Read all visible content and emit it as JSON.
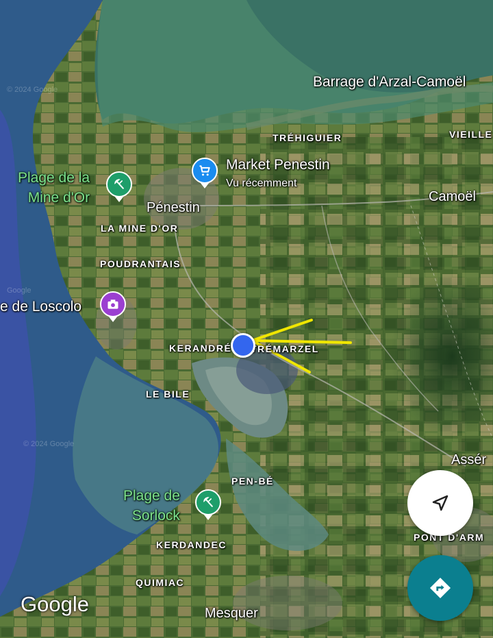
{
  "map": {
    "places": {
      "barrage": "Barrage d'Arzal-Camoël",
      "trehiguier": "TRÉHIGUIER",
      "vieille": "VIEILLE",
      "camoel": "Camoël",
      "penestin": "Pénestin",
      "la_mine_dor": "LA MINE D'OR",
      "poudrantais": "POUDRANTAIS",
      "kerandre": "KERANDRÉ",
      "tremarzel": "TRÉMARZEL",
      "le_bile": "LE BILE",
      "assere": "Assér",
      "pen_be": "PEN-BÉ",
      "kerdandec": "KERDANDEC",
      "quimiac": "QUIMIAC",
      "mesquer": "Mesquer",
      "pont_darm": "PONT D'ARM"
    },
    "pois": {
      "market": {
        "name": "Market Penestin",
        "subtitle": "Vu récemment",
        "icon": "shopping-cart-icon",
        "color": "#1a8cf0"
      },
      "mine_dor": {
        "line1": "Plage de la",
        "line2": "Mine d'Or",
        "icon": "beach-umbrella-icon",
        "color": "#1e9e6a"
      },
      "loscolo": {
        "name": "e de Loscolo",
        "icon": "camera-icon",
        "color": "#9b3fd1"
      },
      "sorlock": {
        "line1": "Plage de",
        "line2": "Sorlock",
        "icon": "beach-umbrella-icon",
        "color": "#1e9e6a"
      }
    },
    "watermarks": {
      "wm1": "© 2024 Google",
      "wm2": "Google",
      "wm3": "© 2024 Google"
    },
    "annotation": {
      "type": "yellow-arrow",
      "color": "#f0e600"
    }
  },
  "controls": {
    "my_location_button": {
      "icon": "navigation-arrow-icon"
    },
    "directions_button": {
      "icon": "directions-icon",
      "color": "#0b7f8f"
    }
  },
  "branding": {
    "logo": "Google"
  }
}
